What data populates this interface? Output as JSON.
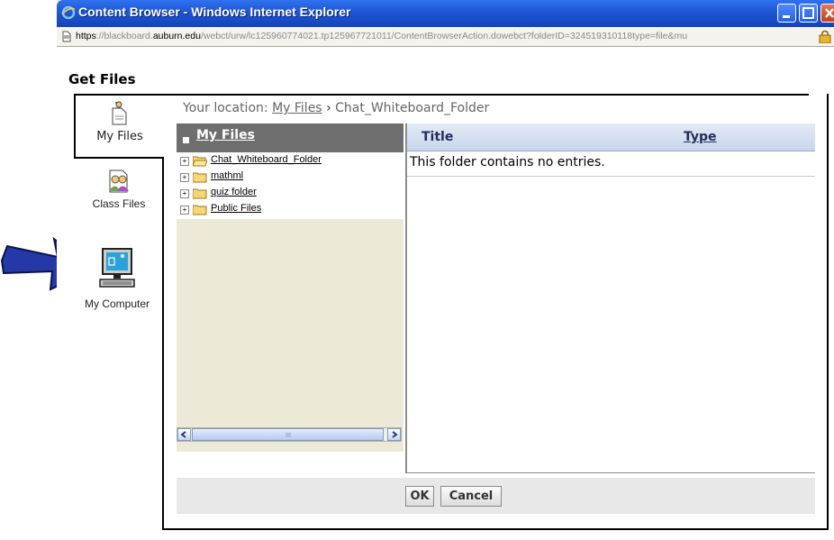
{
  "window": {
    "title": "Content Browser - Windows Internet Explorer",
    "url_proto": "https",
    "url_pre": "://blackboard.",
    "url_host": "auburn.edu",
    "url_rest": "/webct/urw/lc125960774021.tp125967721011/ContentBrowserAction.dowebct?folderID=324519310118type=file&mu"
  },
  "page": {
    "heading": "Get Files"
  },
  "sidebar": {
    "items": [
      {
        "label": "My Files",
        "icon": "my-files-icon"
      },
      {
        "label": "Class Files",
        "icon": "class-files-icon"
      },
      {
        "label": "My Computer",
        "icon": "computer-icon"
      }
    ]
  },
  "location": {
    "prefix": "Your location:",
    "link": "My Files",
    "separator": "›",
    "current": "Chat_Whiteboard_Folder"
  },
  "tree": {
    "header": "My Files",
    "folders": [
      {
        "name": "Chat_Whiteboard_Folder",
        "open": true
      },
      {
        "name": "mathml",
        "open": false
      },
      {
        "name": "quiz folder",
        "open": false
      },
      {
        "name": "Public Files",
        "open": false
      }
    ]
  },
  "list": {
    "col_title": "Title",
    "col_type": "Type",
    "empty_message": "This folder contains no entries."
  },
  "buttons": {
    "ok": "OK",
    "cancel": "Cancel"
  },
  "colors": {
    "titlebar": "#1e56d4",
    "tree_header": "#6e6e6e",
    "arrow": "#1f3a9e"
  }
}
